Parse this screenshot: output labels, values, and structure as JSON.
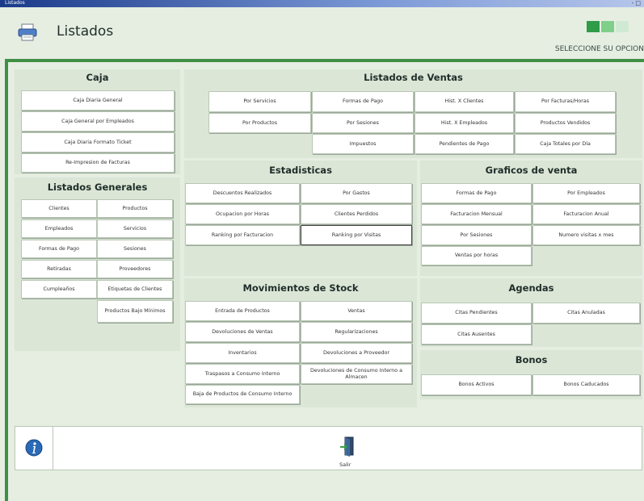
{
  "window": {
    "title": "Listados",
    "controls": "- □"
  },
  "header": {
    "title": "Listados",
    "hint": "SELECCIONE SU OPCION",
    "squares": [
      "#2e9c48",
      "#7fcf8b",
      "#cfe9d2"
    ]
  },
  "caja": {
    "title": "Caja",
    "buttons": [
      "Caja Diaria General",
      "Caja General por Empleados",
      "Caja Diaria Formato Ticket",
      "Re-Impresion de Facturas"
    ]
  },
  "generales": {
    "title": "Listados Generales",
    "buttons": [
      "Clientes",
      "Productos",
      "Empleados",
      "Servicios",
      "Formas de Pago",
      "Sesiones",
      "Retiradas",
      "Proveedores",
      "Cumpleaños",
      "Etiquetas de Clientes",
      "Productos Bajo Mínimos"
    ]
  },
  "ventas": {
    "title": "Listados de Ventas",
    "buttons": [
      "Por Servicios",
      "Formas de Pago",
      "Hist. X Clientes",
      "Por Facturas/Horas",
      "Por Productos",
      "Por Sesiones",
      "Hist. X Empleados",
      "Productos Vendidos",
      "Impuestos",
      "Pendientes de Pago",
      "Caja Totales por Día"
    ]
  },
  "estadisticas": {
    "title": "Estadisticas",
    "buttons": [
      "Descuentos Realizados",
      "Por Gastos",
      "Ocupacion por Horas",
      "Clientes Perdidos",
      "Ranking por Facturacion",
      "Ranking por Visitas"
    ]
  },
  "graficos": {
    "title": "Graficos de venta",
    "buttons": [
      "Formas de Pago",
      "Por Empleados",
      "Facturacion Mensual",
      "Facturacion Anual",
      "Por Sesiones",
      "Numero visitas x mes",
      "Ventas por horas"
    ]
  },
  "stock": {
    "title": "Movimientos de Stock",
    "buttons": [
      "Entrada de Productos",
      "Ventas",
      "Devoluciones de Ventas",
      "Regularizaciones",
      "Inventarios",
      "Devoluciones a Proveedor",
      "Traspasos a Consumo Interno",
      "Devoluciones de Consumo Interno a Almacen",
      "Baja de Productos de Consumo Interno"
    ]
  },
  "agendas": {
    "title": "Agendas",
    "buttons": [
      "Citas Pendientes",
      "Citas Anuladas",
      "Citas Ausentes"
    ]
  },
  "bonos": {
    "title": "Bonos",
    "buttons": [
      "Bonos Activos",
      "Bonos Caducados"
    ]
  },
  "footer": {
    "info_icon": "info-icon",
    "exit_icon": "exit-door-icon",
    "exit_label": "Salir"
  }
}
